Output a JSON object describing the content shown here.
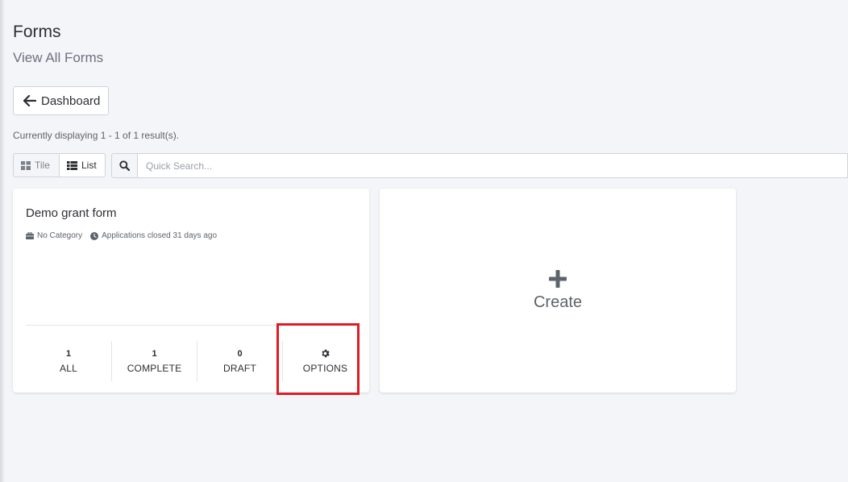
{
  "page": {
    "title": "Forms",
    "subtitle": "View All Forms"
  },
  "nav": {
    "back_label": "Dashboard"
  },
  "results": {
    "summary": "Currently displaying 1 - 1 of 1 result(s)."
  },
  "view_toggle": {
    "tile_label": "Tile",
    "list_label": "List",
    "selected": "List"
  },
  "search": {
    "placeholder": "Quick Search..."
  },
  "forms": [
    {
      "title": "Demo grant form",
      "category": "No Category",
      "status": "Applications closed 31 days ago",
      "stats": {
        "all_value": "1",
        "all_label": "ALL",
        "complete_value": "1",
        "complete_label": "COMPLETE",
        "draft_value": "0",
        "draft_label": "DRAFT",
        "options_label": "OPTIONS"
      }
    }
  ],
  "create": {
    "label": "Create"
  },
  "icons": {
    "back": "arrow-left-icon",
    "tile": "grid-icon",
    "list": "list-icon",
    "search": "search-icon",
    "category": "briefcase-icon",
    "status": "clock-icon",
    "options": "gear-icon",
    "create": "plus-icon"
  },
  "colors": {
    "background": "#f4f5f8",
    "highlight": "#e01b24",
    "text": "#2b2e33",
    "muted": "#5d636b"
  }
}
